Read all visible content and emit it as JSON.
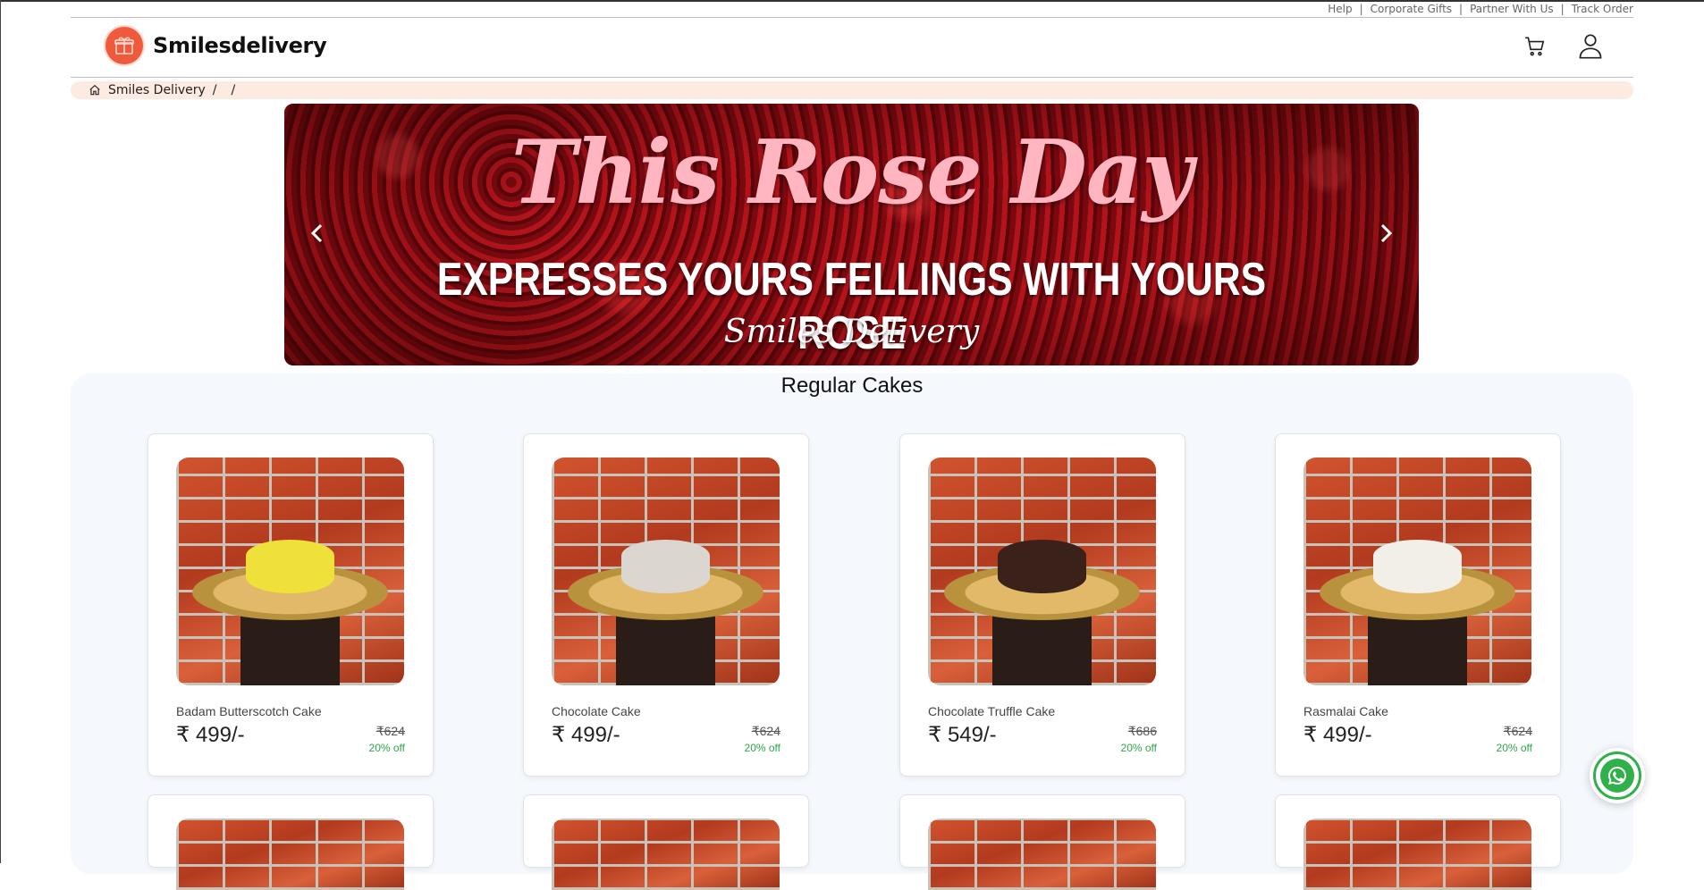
{
  "top_links": [
    "Help",
    "Corporate Gifts",
    "Partner With Us",
    "Track Order"
  ],
  "header": {
    "brand": "Smilesdelivery"
  },
  "breadcrumb": {
    "home_label": "Smiles Delivery",
    "sep1": "/",
    "sep2": "/"
  },
  "banner": {
    "title": "This Rose Day",
    "subtitle": "EXPRESSES YOURS  FELLINGS WITH YOURS ROSE",
    "brand": "Smiles Delivery"
  },
  "section": {
    "title": "Regular Cakes"
  },
  "products": [
    {
      "name": "Badam Butterscotch Cake",
      "price": "₹ 499/-",
      "mrp": "₹624",
      "discount": "20% off",
      "cake_color": "#efe13a"
    },
    {
      "name": "Chocolate Cake",
      "price": "₹ 499/-",
      "mrp": "₹624",
      "discount": "20% off",
      "cake_color": "#dcd6d0"
    },
    {
      "name": "Chocolate Truffle Cake",
      "price": "₹ 549/-",
      "mrp": "₹686",
      "discount": "20% off",
      "cake_color": "#3a221b"
    },
    {
      "name": "Rasmalai Cake",
      "price": "₹ 499/-",
      "mrp": "₹624",
      "discount": "20% off",
      "cake_color": "#f2efe8"
    }
  ],
  "colors": {
    "accent": "#f05a3c",
    "discount": "#2ea84a",
    "whatsapp": "#2fb04a"
  },
  "icons": [
    "gift-icon",
    "cart-icon",
    "user-icon",
    "home-icon",
    "chevron-left-icon",
    "chevron-right-icon",
    "whatsapp-icon"
  ]
}
